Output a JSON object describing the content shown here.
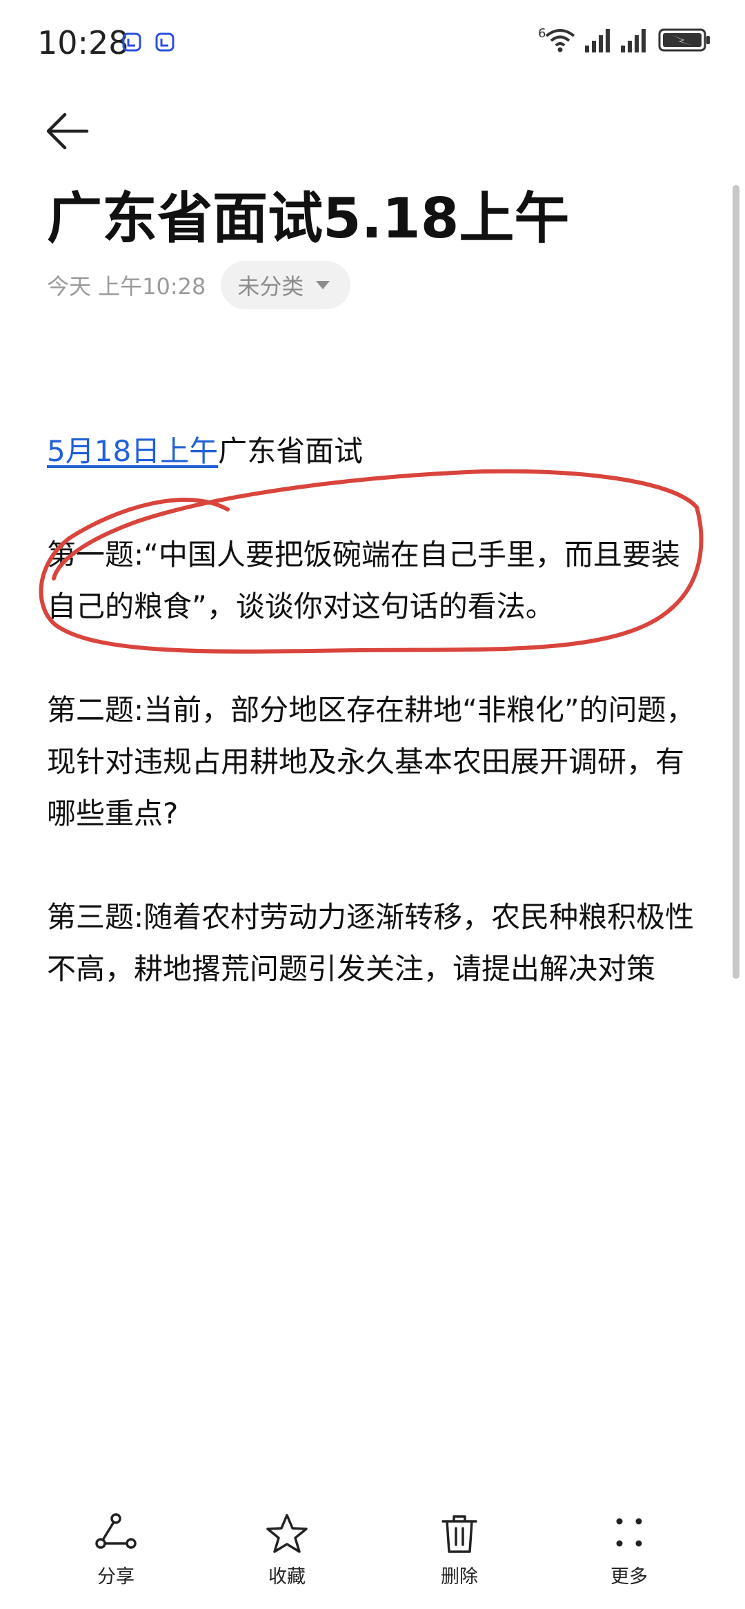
{
  "status_bar": {
    "time": "10:28",
    "network_label": "6",
    "icons": [
      "notification-app-icon",
      "notification-app-icon",
      "wifi-icon",
      "signal-icon",
      "signal-icon",
      "battery-saver-icon"
    ]
  },
  "header": {
    "back_icon": "arrow-left-icon"
  },
  "note": {
    "title": "广东省面试5.18上午",
    "date": "今天 上午10:28",
    "category": "未分类",
    "link_text": "5月18日上午",
    "heading_rest": "广东省面试",
    "question1": "第一题:“中国人要把饭碗端在自己手里，而且要装自己的粮食”，谈谈你对这句话的看法。",
    "question2": "第二题:当前，部分地区存在耕地“非粮化”的问题，现针对违规占用耕地及永久基本农田展开调研，有哪些重点?",
    "question3": "第三题:随着农村劳动力逐渐转移，农民种粮积极性不高，耕地撂荒问题引发关注，请提出解决对策"
  },
  "colors": {
    "link": "#2060d8",
    "annotation": "#d9443c",
    "muted": "#9a9a9a"
  },
  "toolbar": {
    "share_label": "分享",
    "favorite_label": "收藏",
    "delete_label": "删除",
    "more_label": "更多"
  }
}
